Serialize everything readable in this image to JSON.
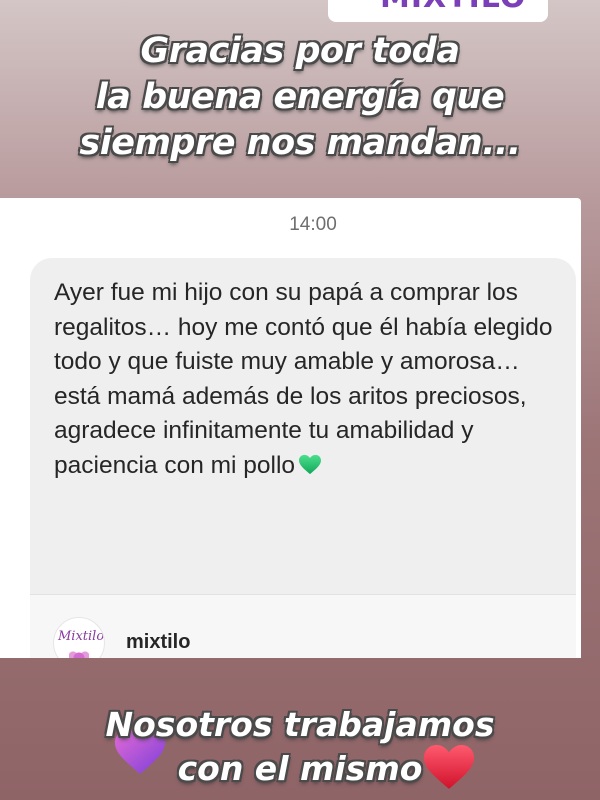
{
  "top_sticker": {
    "text": "MIXTILO"
  },
  "headline": {
    "lines": [
      "Gracias por toda",
      "la buena energía que",
      "siempre nos mandan..."
    ]
  },
  "message": {
    "time": "14:00",
    "text": "Ayer fue mi hijo con su papá a comprar los regalitos… hoy me contó que él había elegido todo y que fuiste muy amable y amorosa…está mamá además de los aritos preciosos, agradece infinitamente tu amabilidad y paciencia con mi pollo",
    "emoji_icon": "green-heart-icon",
    "shared_post": {
      "avatar_text": "Mixtilo",
      "account": "mixtilo"
    }
  },
  "footer": {
    "lines": [
      "Nosotros trabajamos",
      "con el mismo"
    ],
    "icons": [
      "purple-heart-icon",
      "red-heart-icon"
    ]
  },
  "colors": {
    "heart_green": "#1fbf6a",
    "heart_purple": "#b04ad8",
    "heart_red": "#e5223d",
    "brand_purple": "#7b3fb8"
  }
}
